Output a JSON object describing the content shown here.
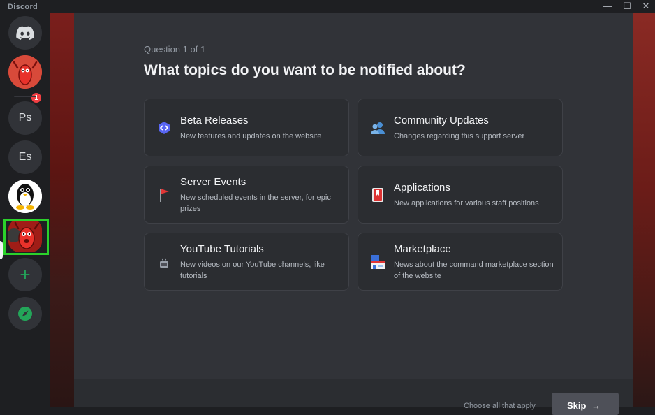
{
  "app": {
    "title": "Discord"
  },
  "window_controls": {
    "minimize": "—",
    "maximize": "☐",
    "close": "✕"
  },
  "servers": [
    {
      "kind": "home",
      "label": ""
    },
    {
      "kind": "image",
      "label": "",
      "badge": "1"
    },
    {
      "kind": "text",
      "label": "Ps"
    },
    {
      "kind": "text",
      "label": "Es"
    },
    {
      "kind": "image",
      "label": ""
    },
    {
      "kind": "image",
      "label": "",
      "selected": true
    },
    {
      "kind": "add",
      "label": "+"
    },
    {
      "kind": "explore",
      "label": ""
    }
  ],
  "onboarding": {
    "question_count": "Question 1 of 1",
    "question": "What topics do you want to be notified about?",
    "options": [
      {
        "title": "Beta Releases",
        "description": "New features and updates on the website",
        "icon": "code-icon"
      },
      {
        "title": "Community Updates",
        "description": "Changes regarding this support server",
        "icon": "people-icon"
      },
      {
        "title": "Server Events",
        "description": "New scheduled events in the server, for epic prizes",
        "icon": "flag-icon"
      },
      {
        "title": "Applications",
        "description": "New applications for various staff positions",
        "icon": "bookmark-icon"
      },
      {
        "title": "YouTube Tutorials",
        "description": "New videos on our YouTube channels, like tutorials",
        "icon": "tv-icon"
      },
      {
        "title": "Marketplace",
        "description": "News about the command marketplace section of the website",
        "icon": "store-icon"
      }
    ],
    "footer_hint": "Choose all that apply",
    "skip_label": "Skip"
  },
  "colors": {
    "accent_highlight": "#2bd12b",
    "badge": "#f23f43",
    "add_green": "#23a559"
  }
}
